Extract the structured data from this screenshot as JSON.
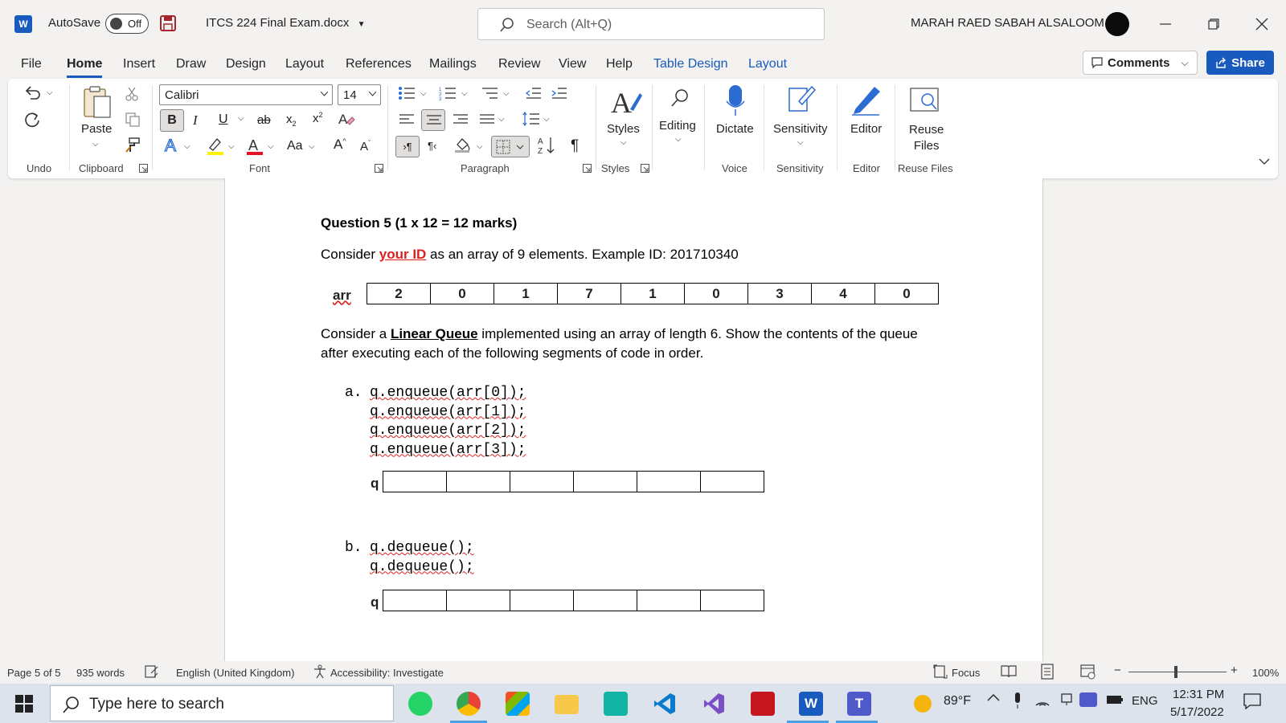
{
  "titlebar": {
    "app_logo": "W",
    "autosave_label": "AutoSave",
    "autosave_state": "Off",
    "doc_title": "ITCS 224 Final Exam.docx",
    "search_placeholder": "Search (Alt+Q)",
    "user_name": "MARAH RAED SABAH ALSALOOM"
  },
  "menu": {
    "file": "File",
    "home": "Home",
    "insert": "Insert",
    "draw": "Draw",
    "design": "Design",
    "layout": "Layout",
    "references": "References",
    "mailings": "Mailings",
    "review": "Review",
    "view": "View",
    "help": "Help",
    "table_design": "Table Design",
    "table_layout": "Layout",
    "comments": "Comments",
    "share": "Share"
  },
  "ribbon": {
    "undo_group": "Undo",
    "paste": "Paste",
    "clipboard_group": "Clipboard",
    "font_name": "Calibri",
    "font_size": "14",
    "font_group": "Font",
    "paragraph_group": "Paragraph",
    "styles": "Styles",
    "styles_group": "Styles",
    "editing": "Editing",
    "dictate": "Dictate",
    "voice_group": "Voice",
    "sensitivity": "Sensitivity",
    "sensitivity_group": "Sensitivity",
    "editor": "Editor",
    "editor_group": "Editor",
    "reuse_files_1": "Reuse",
    "reuse_files_2": "Files",
    "reuse_group": "Reuse Files"
  },
  "document": {
    "question_title": "Question 5 (1 x 12 = 12 marks)",
    "intro_pre": "Consider ",
    "intro_highlight": "your ID",
    "intro_post": " as an array of 9 elements. Example ID: 201710340",
    "arr_label": "arr",
    "arr_values": [
      "2",
      "0",
      "1",
      "7",
      "1",
      "0",
      "3",
      "4",
      "0"
    ],
    "queue_pre": "Consider a ",
    "queue_highlight": "Linear Queue",
    "queue_post": " implemented using an array of length 6. Show the contents of the queue",
    "queue_line2": "after executing each of the following segments of code in order.",
    "part_a_label": "a.",
    "part_a_code": [
      "q.enqueue(arr[0]);",
      "q.enqueue(arr[1]);",
      "q.enqueue(arr[2]);",
      "q.enqueue(arr[3]);"
    ],
    "q_label": "q",
    "part_b_label": "b.",
    "part_b_code": [
      "q.dequeue();",
      "q.dequeue();"
    ]
  },
  "statusbar": {
    "page": "Page 5 of 5",
    "words": "935 words",
    "language": "English (United Kingdom)",
    "accessibility": "Accessibility: Investigate",
    "focus": "Focus",
    "zoom": "100%"
  },
  "taskbar": {
    "search_placeholder": "Type here to search",
    "weather": "89°F",
    "lang": "ENG",
    "time": "12:31 PM",
    "date": "5/17/2022"
  }
}
